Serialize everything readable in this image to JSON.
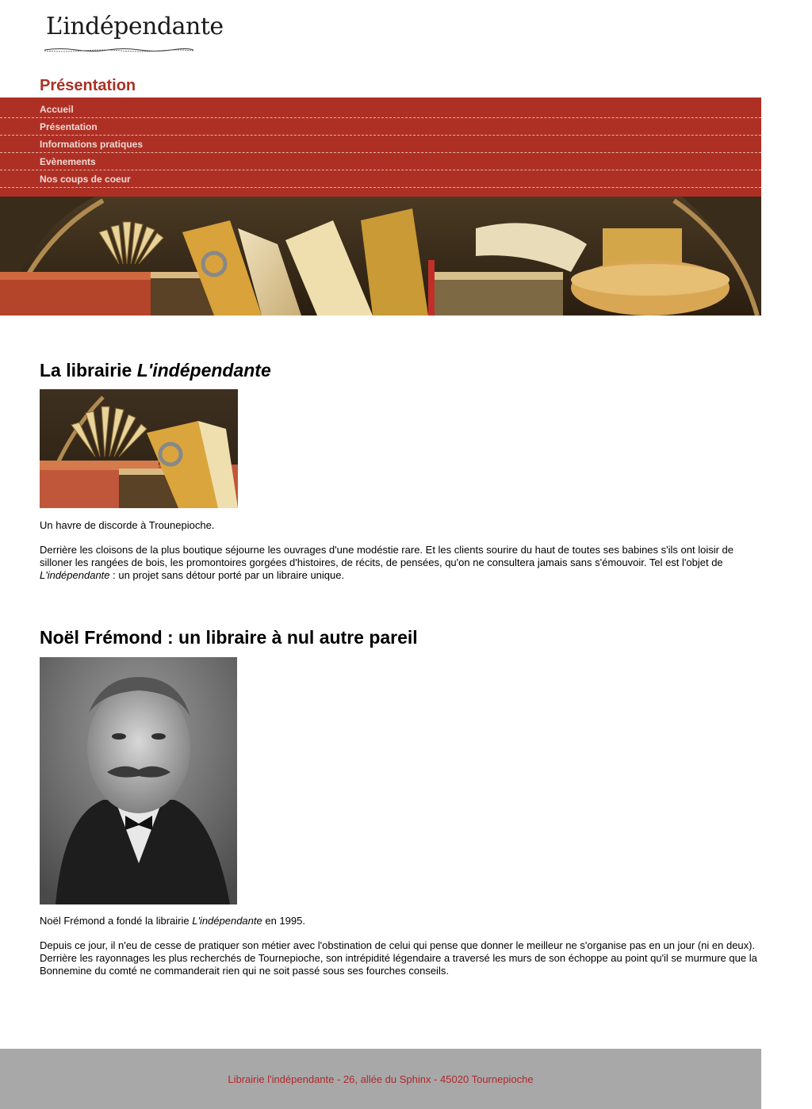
{
  "site": {
    "logo_text": "L’indépendante"
  },
  "page_title": "Présentation",
  "nav": {
    "items": [
      {
        "label": "Accueil"
      },
      {
        "label": "Présentation"
      },
      {
        "label": "Informations pratiques"
      },
      {
        "label": "Evènements"
      },
      {
        "label": "Nos coups de coeur"
      }
    ]
  },
  "colors": {
    "brand_red": "#ae3024",
    "heading_red": "#a93226",
    "footer_bg": "#a8a8a8",
    "footer_text": "#b0282c"
  },
  "section1": {
    "title_prefix": "La librairie ",
    "title_italic": "L'indépendante",
    "tagline": "Un havre de discorde à Trounepioche.",
    "body_main": "Derrière les cloisons de la plus boutique séjourne les ouvrages d'une modéstie rare. Et les clients sourire du haut de toutes ses babines s'ils ont loisir de silloner les rangées de bois, les promontoires gorgées d'histoires, de récits, de pensées, qu'on ne consultera jamais sans s'émouvoir. Tel est l'objet de ",
    "body_italic": "L'indépendante",
    "body_end": " : un projet sans détour porté par un libraire unique."
  },
  "section2": {
    "title": "Noël Frémond : un libraire à nul autre pareil",
    "intro_prefix": "Noël Frémond a fondé la librairie ",
    "intro_italic": "L'indépendante",
    "intro_suffix": " en 1995.",
    "body": "Depuis ce jour, il n'eu de cesse de pratiquer son métier avec l'obstination de celui qui pense que donner le meilleur ne s'organise pas en un jour (ni en deux). Derrière les rayonnages les plus recherchés de Tournepioche, son intrépidité légendaire a traversé les murs de son échoppe au point qu'il se murmure que la Bonnemine du comté ne commanderait rien qui ne soit passé sous ses fourches conseils."
  },
  "footer": {
    "text": "Librairie l'indépendante - 26, allée du Sphinx - 45020 Tournepioche"
  }
}
